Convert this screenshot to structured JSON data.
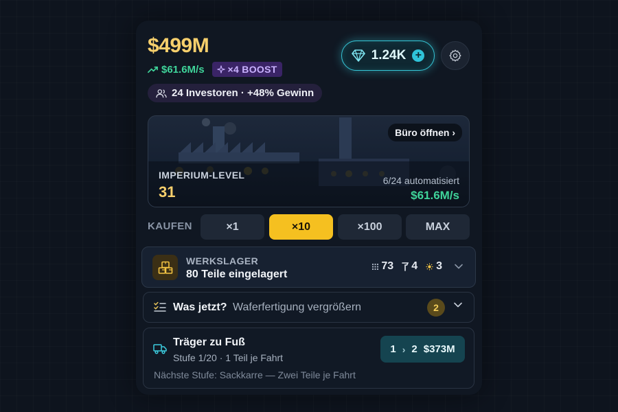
{
  "header": {
    "money": "$499M",
    "rate": "$61.6M/s",
    "boost": "×4 BOOST",
    "investors": "24 Investoren · +48% Gewinn",
    "gems": "1.24K",
    "gems_plus": "+"
  },
  "empire": {
    "office_button": "Büro öffnen ›",
    "level_label": "IMPERIUM-LEVEL",
    "level_value": "31",
    "automated": "6/24 automatisiert",
    "rate": "$61.6M/s"
  },
  "buy": {
    "label": "KAUFEN",
    "options": [
      "×1",
      "×10",
      "×100",
      "MAX"
    ],
    "active": "×10"
  },
  "storage": {
    "title": "WERKSLAGER",
    "subtitle": "80 Teile eingelagert",
    "stats": [
      "73",
      "4",
      "3"
    ]
  },
  "next": {
    "question": "Was jetzt?",
    "text": "Waferfertigung vergrößern",
    "badge": "2"
  },
  "carrier": {
    "title": "Träger zu Fuß",
    "subtitle": "Stufe 1/20 · 1 Teil je Fahrt",
    "next_level": "Nächste Stufe: Sackkarre — Zwei Teile je Fahrt",
    "from": "1",
    "to": "2",
    "cost": "$373M"
  },
  "colors": {
    "gold": "#f6cf6c",
    "green": "#3fd49a",
    "cyan": "#36c7d8",
    "boost_purple": "#3a2466",
    "active_yellow": "#f5c020"
  },
  "icons": [
    "trend-up-icon",
    "sparkle-icon",
    "users-icon",
    "diamond-icon",
    "plus-icon",
    "gear-icon",
    "crate-icon",
    "chevron-down-icon",
    "checklist-icon",
    "truck-icon",
    "chevron-right-icon"
  ]
}
